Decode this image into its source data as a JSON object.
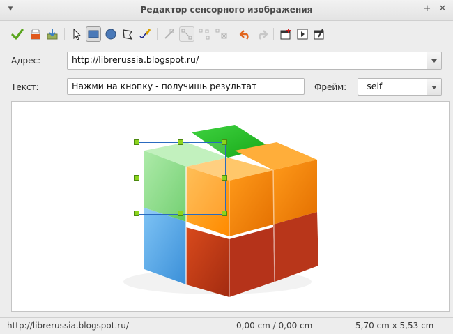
{
  "window": {
    "title": "Редактор сенсорного изображения",
    "pin_icon": "+",
    "close_icon": "✕",
    "menu_icon": "▾"
  },
  "toolbar": {
    "tools": [
      {
        "name": "apply-icon"
      },
      {
        "name": "open-icon"
      },
      {
        "name": "save-icon"
      },
      {
        "name": "select-icon"
      },
      {
        "name": "rectangle-icon"
      },
      {
        "name": "ellipse-icon"
      },
      {
        "name": "polygon-icon"
      },
      {
        "name": "freeform-icon"
      },
      {
        "name": "edit-points-icon"
      },
      {
        "name": "move-points-icon"
      },
      {
        "name": "insert-points-icon"
      },
      {
        "name": "delete-points-icon"
      },
      {
        "name": "undo-icon"
      },
      {
        "name": "redo-icon"
      },
      {
        "name": "active-icon"
      },
      {
        "name": "macro-icon"
      },
      {
        "name": "properties-icon"
      }
    ]
  },
  "form": {
    "address_label": "Адрес:",
    "address_value": "http://librerussia.blogspot.ru/",
    "text_label": "Текст:",
    "text_value": "Нажми на кнопку - получишь результат",
    "frame_label": "Фрейм:",
    "frame_value": "_self"
  },
  "statusbar": {
    "url": "http://librerussia.blogspot.ru/",
    "position": "0,00 cm / 0,00 cm",
    "size": "5,70 cm x 5,53 cm"
  },
  "colors": {
    "accent": "#2a6bbf",
    "handle": "#8cd41e"
  }
}
